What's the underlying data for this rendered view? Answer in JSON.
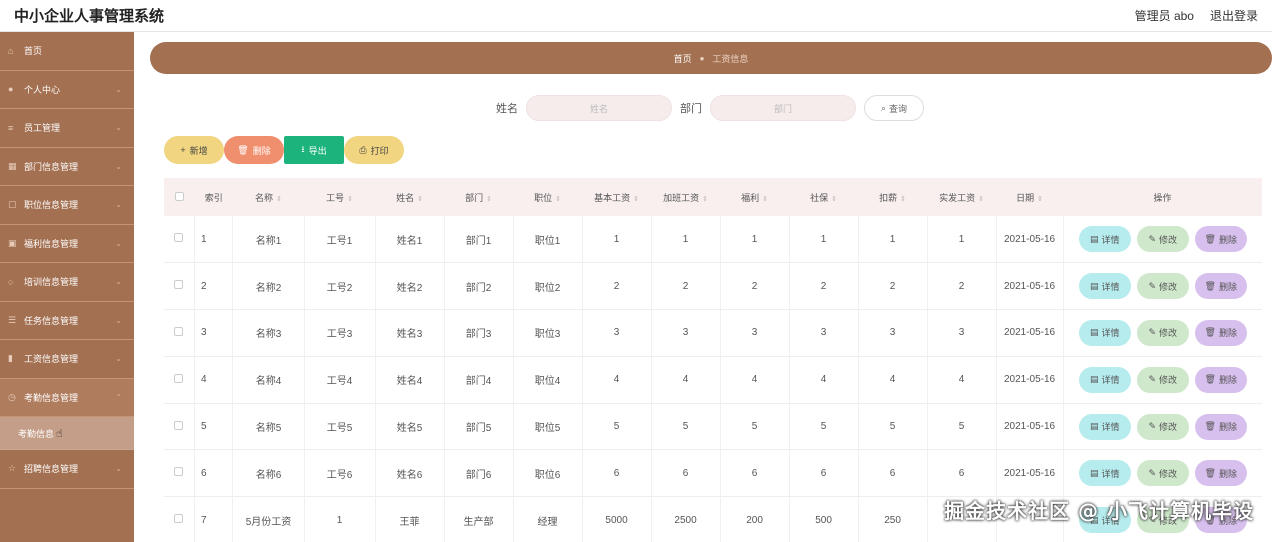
{
  "app": {
    "title": "中小企业人事管理系统"
  },
  "user": {
    "role_name": "管理员 abo",
    "logout": "退出登录"
  },
  "sidebar": {
    "items": [
      {
        "label": "首页",
        "icon": "home-icon"
      },
      {
        "label": "个人中心",
        "icon": "user-icon"
      },
      {
        "label": "员工管理",
        "icon": "list-icon"
      },
      {
        "label": "部门信息管理",
        "icon": "grid-icon"
      },
      {
        "label": "职位信息管理",
        "icon": "doc-icon"
      },
      {
        "label": "福利信息管理",
        "icon": "gift-icon"
      },
      {
        "label": "培训信息管理",
        "icon": "circle-icon"
      },
      {
        "label": "任务信息管理",
        "icon": "task-icon"
      },
      {
        "label": "工资信息管理",
        "icon": "bar-icon"
      },
      {
        "label": "考勤信息管理",
        "icon": "clock-icon"
      }
    ],
    "sub_item": "考勤信息",
    "last_item": {
      "label": "招聘信息管理",
      "icon": "star-icon"
    }
  },
  "breadcrumb": {
    "home": "首页",
    "separator": "●",
    "current": "工资信息"
  },
  "search": {
    "name_label": "姓名",
    "name_placeholder": "姓名",
    "dept_label": "部门",
    "dept_placeholder": "部门",
    "button": "查询"
  },
  "actions": {
    "add": "新增",
    "delete": "删除",
    "export": "导出",
    "print": "打印"
  },
  "table": {
    "headers": [
      "索引",
      "名称",
      "工号",
      "姓名",
      "部门",
      "职位",
      "基本工资",
      "加班工资",
      "福利",
      "社保",
      "扣薪",
      "实发工资",
      "日期",
      "操作"
    ],
    "row_actions": {
      "detail": "详情",
      "edit": "修改",
      "delete": "删除"
    },
    "rows": [
      [
        "1",
        "名称1",
        "工号1",
        "姓名1",
        "部门1",
        "职位1",
        "1",
        "1",
        "1",
        "1",
        "1",
        "1",
        "2021-05-16"
      ],
      [
        "2",
        "名称2",
        "工号2",
        "姓名2",
        "部门2",
        "职位2",
        "2",
        "2",
        "2",
        "2",
        "2",
        "2",
        "2021-05-16"
      ],
      [
        "3",
        "名称3",
        "工号3",
        "姓名3",
        "部门3",
        "职位3",
        "3",
        "3",
        "3",
        "3",
        "3",
        "3",
        "2021-05-16"
      ],
      [
        "4",
        "名称4",
        "工号4",
        "姓名4",
        "部门4",
        "职位4",
        "4",
        "4",
        "4",
        "4",
        "4",
        "4",
        "2021-05-16"
      ],
      [
        "5",
        "名称5",
        "工号5",
        "姓名5",
        "部门5",
        "职位5",
        "5",
        "5",
        "5",
        "5",
        "5",
        "5",
        "2021-05-16"
      ],
      [
        "6",
        "名称6",
        "工号6",
        "姓名6",
        "部门6",
        "职位6",
        "6",
        "6",
        "6",
        "6",
        "6",
        "6",
        "2021-05-16"
      ],
      [
        "7",
        "5月份工资",
        "1",
        "王菲",
        "生产部",
        "经理",
        "5000",
        "2500",
        "200",
        "500",
        "250",
        "",
        ""
      ]
    ]
  },
  "watermark": "掘金技术社区 @ 小飞计算机毕设",
  "colors": {
    "sidebar": "#a47052",
    "accent_add": "#f1d580",
    "accent_delete": "#f08f6e",
    "accent_export": "#1cb37d"
  }
}
